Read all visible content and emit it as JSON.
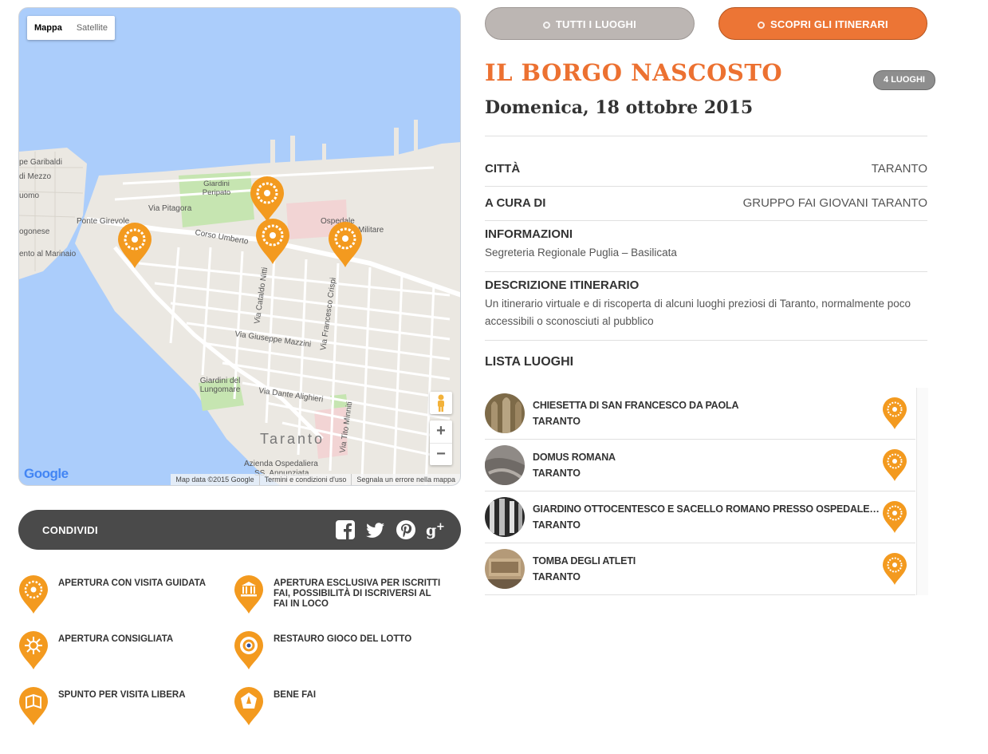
{
  "map": {
    "type_buttons": [
      "Mappa",
      "Satellite"
    ],
    "labels": [
      "Via Pitagora",
      "Ponte Girevole",
      "Giardini Peripato",
      "Corso Umberto",
      "Ospedale",
      "Militare",
      "Via Cataldo Nitti",
      "Via Francesco Crispi",
      "Via Giuseppe Mazzini",
      "Giardini del Lungomare",
      "Via Dante Alighieri",
      "Via Tito Minniti",
      "Taranto",
      "Azienda Ospedaliera",
      "SS. Annunziata",
      "ogonese",
      "ento al Marinaio",
      "pe Garibaldi",
      "di Mezzo",
      "uomo"
    ],
    "zoom_in": "+",
    "zoom_out": "−",
    "logo": "Google",
    "footer": [
      "Map data ©2015 Google",
      "Termini e condizioni d'uso",
      "Segnala un errore nella mappa"
    ]
  },
  "share": {
    "label": "CONDIVIDI",
    "icons": [
      "facebook-icon",
      "twitter-icon",
      "pinterest-icon",
      "google-plus-icon"
    ]
  },
  "legend": [
    {
      "label": "APERTURA CON VISITA GUIDATA",
      "icon": "guided-visit-pin-icon"
    },
    {
      "label": "APERTURA ESCLUSIVA PER ISCRITTI FAI, POSSIBILITÀ DI ISCRIVERSI AL FAI IN LOCO",
      "icon": "members-only-pin-icon"
    },
    {
      "label": "APERTURA CONSIGLIATA",
      "icon": "recommended-pin-icon"
    },
    {
      "label": "RESTAURO GIOCO DEL LOTTO",
      "icon": "lotto-restoration-pin-icon"
    },
    {
      "label": "SPUNTO PER VISITA LIBERA",
      "icon": "free-visit-pin-icon"
    },
    {
      "label": "BENE FAI",
      "icon": "fai-property-pin-icon"
    }
  ],
  "buttons": {
    "all_places": "TUTTI I LUOGHI",
    "itineraries": "SCOPRI GLI ITINERARI"
  },
  "itinerary": {
    "title": "IL BORGO NASCOSTO",
    "badge": "4 LUOGHI",
    "date": "Domenica, 18 ottobre 2015",
    "city_label": "CITTÀ",
    "city_value": "TARANTO",
    "curator_label": "A CURA DI",
    "curator_value": "GRUPPO FAI GIOVANI TARANTO",
    "info_label": "INFORMAZIONI",
    "info_value": "Segreteria Regionale Puglia – Basilicata",
    "desc_label": "DESCRIZIONE ITINERARIO",
    "desc_value": "Un itinerario virtuale e di riscoperta di alcuni luoghi preziosi di Taranto, normalmente poco accessibili o sconosciuti al pubblico",
    "list_title": "LISTA LUOGHI"
  },
  "places": [
    {
      "name": "CHIESETTA DI SAN FRANCESCO DA PAOLA",
      "city": "TARANTO"
    },
    {
      "name": "DOMUS ROMANA",
      "city": "TARANTO"
    },
    {
      "name": "GIARDINO OTTOCENTESCO E SACELLO ROMANO PRESSO OSPEDALE MILITARE",
      "city": "TARANTO"
    },
    {
      "name": "TOMBA DEGLI ATLETI",
      "city": "TARANTO"
    }
  ],
  "colors": {
    "accent_orange": "#ec7131",
    "pin_orange": "#f39a1f",
    "share_bar": "#4a4a4a",
    "button_grey": "#bcb6b3",
    "water": "#abcdfb",
    "land": "#ebe8e2"
  }
}
